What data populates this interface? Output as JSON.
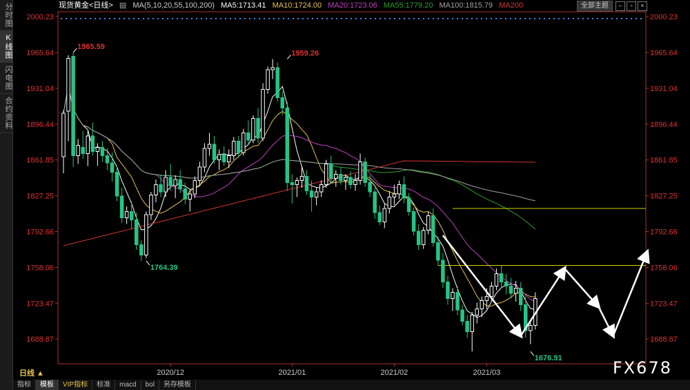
{
  "sidebar": {
    "tabs": [
      {
        "label": "分时图",
        "active": false
      },
      {
        "label": "K线图",
        "active": true
      },
      {
        "label": "闪电图",
        "active": false
      },
      {
        "label": "合约资料",
        "active": false
      }
    ]
  },
  "header": {
    "symbol": "现货黄金<日线>",
    "ma_label": "MA(5,10,20,55,100,200)",
    "ma5": "MA5:1713.41",
    "ma10": "MA10:1724.00",
    "ma20": "MA20:1723.06",
    "ma55": "MA55:1779.20",
    "ma100": "MA100:1815.79",
    "ma200": "MA200",
    "theme_button": "全部主题"
  },
  "period_label": "日线 ▲",
  "bottom_tabs": [
    "指标",
    "模板",
    "VIP指标",
    "标准",
    "macd",
    "bol",
    "另存模板"
  ],
  "watermark": "FX678",
  "colors": {
    "up": "#ffffff",
    "down": "#25c485",
    "ma5": "#ffffff",
    "ma10": "#e8c34a",
    "ma20": "#c040c0",
    "ma55": "#2ca02c",
    "ma100": "#a0a0a0",
    "ma200": "#d93535",
    "axis_text": "#e03030",
    "level_line": "#d4d400"
  },
  "chart_data": {
    "type": "candlestick",
    "ylim": [
      1665,
      2005
    ],
    "y_ticks": [
      2000.23,
      1965.64,
      1931.04,
      1896.44,
      1861.85,
      1827.25,
      1792.66,
      1758.06,
      1723.47,
      1688.87
    ],
    "x_ticks": [
      {
        "label": "2020/12",
        "index": 22
      },
      {
        "label": "2021/01",
        "index": 47
      },
      {
        "label": "2021/02",
        "index": 68
      },
      {
        "label": "2021/03",
        "index": 87
      }
    ],
    "annotations": [
      {
        "text": "1965.59",
        "index": 2,
        "value": 1965.59,
        "side": "high"
      },
      {
        "text": "1959.26",
        "index": 46,
        "value": 1959.26,
        "side": "high"
      },
      {
        "text": "1764.39",
        "index": 17,
        "value": 1764.39,
        "side": "low"
      },
      {
        "text": "1676.91",
        "index": 96,
        "value": 1676.91,
        "side": "low"
      }
    ],
    "levels": [
      {
        "value": 1815,
        "from_index": 80
      },
      {
        "value": 1760,
        "from_index": 77
      }
    ],
    "pattern_arrows": [
      [
        [
          78,
          1789
        ],
        [
          94,
          1692
        ],
        [
          103,
          1757
        ],
        [
          110,
          1720
        ],
        [
          113,
          1692
        ],
        [
          120,
          1773
        ]
      ]
    ],
    "candles": [
      [
        1865,
        1910,
        1849,
        1907
      ],
      [
        1909,
        1963,
        1880,
        1960
      ],
      [
        1962,
        1965.59,
        1855,
        1866
      ],
      [
        1866,
        1882,
        1858,
        1876
      ],
      [
        1874,
        1890,
        1863,
        1868
      ],
      [
        1868,
        1890,
        1856,
        1885
      ],
      [
        1885,
        1898,
        1866,
        1870
      ],
      [
        1870,
        1878,
        1856,
        1874
      ],
      [
        1874,
        1880,
        1860,
        1866
      ],
      [
        1866,
        1873,
        1852,
        1859
      ],
      [
        1859,
        1869,
        1841,
        1850
      ],
      [
        1850,
        1856,
        1822,
        1827
      ],
      [
        1827,
        1835,
        1801,
        1806
      ],
      [
        1806,
        1817,
        1800,
        1812
      ],
      [
        1812,
        1822,
        1795,
        1804
      ],
      [
        1804,
        1811,
        1775,
        1780
      ],
      [
        1780,
        1784,
        1764.39,
        1770
      ],
      [
        1770,
        1812,
        1767,
        1809
      ],
      [
        1809,
        1831,
        1804,
        1828
      ],
      [
        1828,
        1843,
        1821,
        1838
      ],
      [
        1838,
        1848,
        1826,
        1831
      ],
      [
        1831,
        1852,
        1826,
        1845
      ],
      [
        1845,
        1858,
        1832,
        1837
      ],
      [
        1837,
        1847,
        1825,
        1843
      ],
      [
        1843,
        1852,
        1830,
        1834
      ],
      [
        1834,
        1840,
        1819,
        1824
      ],
      [
        1824,
        1833,
        1812,
        1829
      ],
      [
        1829,
        1846,
        1825,
        1842
      ],
      [
        1842,
        1860,
        1838,
        1855
      ],
      [
        1855,
        1878,
        1850,
        1873
      ],
      [
        1873,
        1888,
        1866,
        1877
      ],
      [
        1877,
        1885,
        1858,
        1862
      ],
      [
        1862,
        1872,
        1852,
        1867
      ],
      [
        1867,
        1875,
        1856,
        1860
      ],
      [
        1860,
        1872,
        1854,
        1866
      ],
      [
        1866,
        1884,
        1862,
        1880
      ],
      [
        1880,
        1885,
        1864,
        1869
      ],
      [
        1869,
        1892,
        1866,
        1888
      ],
      [
        1888,
        1900,
        1876,
        1881
      ],
      [
        1881,
        1905,
        1878,
        1902
      ],
      [
        1902,
        1912,
        1878,
        1883
      ],
      [
        1883,
        1936,
        1880,
        1930
      ],
      [
        1930,
        1952,
        1926,
        1949
      ],
      [
        1949,
        1959.26,
        1940,
        1951
      ],
      [
        1951,
        1956,
        1918,
        1922
      ],
      [
        1922,
        1928,
        1905,
        1912
      ],
      [
        1912,
        1918,
        1832,
        1840
      ],
      [
        1840,
        1848,
        1820,
        1838
      ],
      [
        1838,
        1845,
        1826,
        1842
      ],
      [
        1842,
        1856,
        1835,
        1846
      ],
      [
        1846,
        1852,
        1828,
        1832
      ],
      [
        1832,
        1842,
        1812,
        1826
      ],
      [
        1826,
        1835,
        1818,
        1831
      ],
      [
        1831,
        1842,
        1826,
        1838
      ],
      [
        1838,
        1862,
        1835,
        1858
      ],
      [
        1858,
        1866,
        1839,
        1844
      ],
      [
        1844,
        1852,
        1836,
        1848
      ],
      [
        1848,
        1855,
        1838,
        1842
      ],
      [
        1842,
        1848,
        1833,
        1845
      ],
      [
        1845,
        1851,
        1834,
        1838
      ],
      [
        1838,
        1848,
        1832,
        1842
      ],
      [
        1842,
        1868,
        1838,
        1860
      ],
      [
        1860,
        1864,
        1836,
        1840
      ],
      [
        1840,
        1847,
        1826,
        1831
      ],
      [
        1831,
        1835,
        1805,
        1811
      ],
      [
        1811,
        1818,
        1799,
        1802
      ],
      [
        1802,
        1820,
        1796,
        1815
      ],
      [
        1815,
        1832,
        1810,
        1826
      ],
      [
        1826,
        1838,
        1818,
        1829
      ],
      [
        1829,
        1842,
        1824,
        1838
      ],
      [
        1838,
        1846,
        1820,
        1825
      ],
      [
        1825,
        1830,
        1808,
        1812
      ],
      [
        1812,
        1816,
        1789,
        1793
      ],
      [
        1793,
        1800,
        1775,
        1780
      ],
      [
        1780,
        1797,
        1776,
        1794
      ],
      [
        1794,
        1812,
        1790,
        1808
      ],
      [
        1808,
        1815,
        1778,
        1782
      ],
      [
        1782,
        1788,
        1760,
        1765
      ],
      [
        1765,
        1772,
        1738,
        1744
      ],
      [
        1744,
        1750,
        1722,
        1728
      ],
      [
        1728,
        1738,
        1716,
        1734
      ],
      [
        1734,
        1740,
        1712,
        1717
      ],
      [
        1717,
        1722,
        1702,
        1706
      ],
      [
        1706,
        1712,
        1690,
        1696
      ],
      [
        1696,
        1715,
        1676.91,
        1712
      ],
      [
        1712,
        1724,
        1704,
        1718
      ],
      [
        1718,
        1730,
        1710,
        1726
      ],
      [
        1726,
        1738,
        1718,
        1730
      ],
      [
        1730,
        1744,
        1726,
        1740
      ],
      [
        1740,
        1757,
        1736,
        1752
      ],
      [
        1752,
        1760,
        1738,
        1744
      ],
      [
        1744,
        1752,
        1732,
        1740
      ],
      [
        1740,
        1748,
        1728,
        1733
      ],
      [
        1733,
        1745,
        1725,
        1738
      ],
      [
        1738,
        1744,
        1716,
        1722
      ],
      [
        1722,
        1730,
        1690,
        1697
      ],
      [
        1697,
        1706,
        1684,
        1702
      ],
      [
        1702,
        1734,
        1698,
        1728
      ]
    ]
  }
}
